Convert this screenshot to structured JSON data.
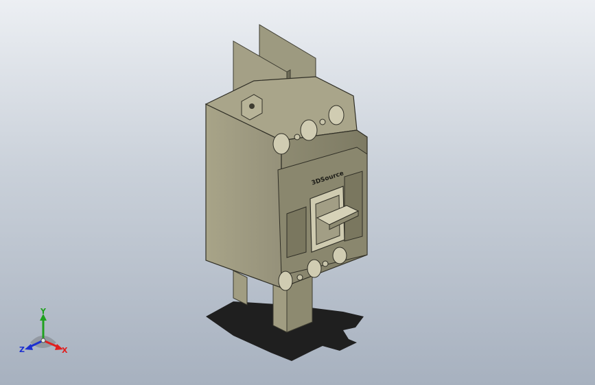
{
  "viewport": {
    "background_top": "#eceff3",
    "background_bottom": "#a7b1bf"
  },
  "model": {
    "label_text": "3DSource",
    "body_color": "#98957a",
    "dark_face_color": "#6c6a57",
    "shadow_color": "#1f1f1f"
  },
  "triad": {
    "x_label": "X",
    "y_label": "Y",
    "z_label": "Z",
    "x_color": "#e01e1e",
    "y_color": "#1fa11f",
    "z_color": "#1c2fd0"
  }
}
